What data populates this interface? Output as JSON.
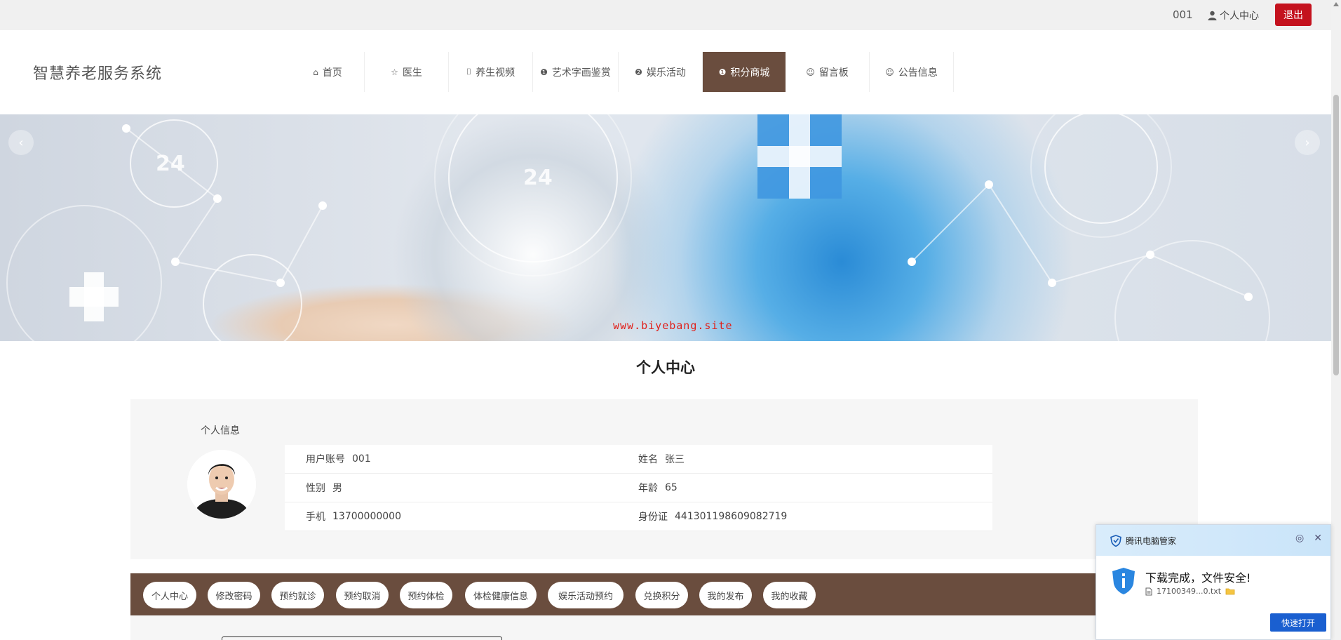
{
  "topbar": {
    "account": "001",
    "personal_center": "个人中心",
    "logout": "退出"
  },
  "header": {
    "brand": "智慧养老服务系统",
    "nav": [
      {
        "label": "首页",
        "icon": "home-icon",
        "glyph": "⌂"
      },
      {
        "label": "医生",
        "icon": "star-icon",
        "glyph": "☆"
      },
      {
        "label": "养生视频",
        "icon": "bag-icon",
        "glyph": "⌷"
      },
      {
        "label": "艺术字画鉴赏",
        "icon": "info-icon",
        "glyph": "❶"
      },
      {
        "label": "娱乐活动",
        "icon": "question-icon",
        "glyph": "❷"
      },
      {
        "label": "积分商城",
        "icon": "exclamation-icon",
        "glyph": "❶"
      },
      {
        "label": "留言板",
        "icon": "smile-icon",
        "glyph": "☺"
      },
      {
        "label": "公告信息",
        "icon": "smile-outline-icon",
        "glyph": "☺"
      }
    ],
    "active_nav_index": 5
  },
  "banner": {
    "watermark": "www.biyebang.site",
    "prev_glyph": "‹",
    "next_glyph": "›"
  },
  "section_title": "个人中心",
  "profile": {
    "label": "个人信息",
    "rows": [
      [
        {
          "key": "用户账号",
          "value": "001"
        },
        {
          "key": "姓名",
          "value": "张三"
        }
      ],
      [
        {
          "key": "性别",
          "value": "男"
        },
        {
          "key": "年龄",
          "value": "65"
        }
      ],
      [
        {
          "key": "手机",
          "value": "13700000000"
        },
        {
          "key": "身份证",
          "value": "441301198609082719"
        }
      ]
    ]
  },
  "tabs": [
    "个人中心",
    "修改密码",
    "预约就诊",
    "预约取消",
    "预约体检",
    "体检健康信息",
    "娱乐活动预约",
    "兑换积分",
    "我的发布",
    "我的收藏"
  ],
  "popup": {
    "title": "腾讯电脑管家",
    "message": "下载完成，文件安全!",
    "file": "17100349...0.txt",
    "open_button": "快速打开"
  },
  "colors": {
    "accent": "#6a4d3e",
    "logout": "#c4121e",
    "popup_button": "#1a5fd0"
  }
}
